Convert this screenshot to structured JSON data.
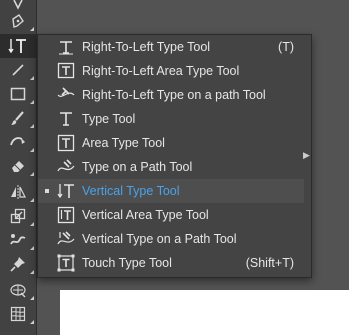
{
  "toolbar": {
    "tools": [
      {
        "name": "anchor-point-icon",
        "active": false
      },
      {
        "name": "pen-icon",
        "active": false
      },
      {
        "name": "vertical-type-icon",
        "active": true
      },
      {
        "name": "line-segment-icon",
        "active": false
      },
      {
        "name": "rectangle-icon",
        "active": false
      },
      {
        "name": "paintbrush-icon",
        "active": false
      },
      {
        "name": "shaper-icon",
        "active": false
      },
      {
        "name": "eraser-icon",
        "active": false
      },
      {
        "name": "reflect-icon",
        "active": false
      },
      {
        "name": "scale-icon",
        "active": false
      },
      {
        "name": "puppet-warp-icon",
        "active": false
      },
      {
        "name": "pin-icon",
        "active": false
      },
      {
        "name": "perspective-grid-icon",
        "active": false
      },
      {
        "name": "mesh-icon",
        "active": false
      }
    ]
  },
  "flyout": {
    "items": [
      {
        "label": "Right-To-Left Type Tool",
        "shortcut": "(T)",
        "icon": "rtl-type-icon",
        "selected": false
      },
      {
        "label": "Right-To-Left Area Type Tool",
        "shortcut": "",
        "icon": "rtl-area-type-icon",
        "selected": false
      },
      {
        "label": "Right-To-Left Type on a path Tool",
        "shortcut": "",
        "icon": "rtl-type-on-path-icon",
        "selected": false
      },
      {
        "label": "Type Tool",
        "shortcut": "",
        "icon": "type-icon",
        "selected": false
      },
      {
        "label": "Area Type Tool",
        "shortcut": "",
        "icon": "area-type-icon",
        "selected": false
      },
      {
        "label": "Type on a Path Tool",
        "shortcut": "",
        "icon": "type-on-path-icon",
        "selected": false
      },
      {
        "label": "Vertical Type Tool",
        "shortcut": "",
        "icon": "vertical-type-icon",
        "selected": true
      },
      {
        "label": "Vertical Area Type Tool",
        "shortcut": "",
        "icon": "vertical-area-type-icon",
        "selected": false
      },
      {
        "label": "Vertical Type on a Path Tool",
        "shortcut": "",
        "icon": "vertical-type-on-path-icon",
        "selected": false
      },
      {
        "label": "Touch Type Tool",
        "shortcut": "(Shift+T)",
        "icon": "touch-type-icon",
        "selected": false
      }
    ]
  },
  "colors": {
    "selected_label": "#4aa3e8",
    "menu_background": "#444444",
    "toolbar_background": "#424242",
    "canvas_background": "#535353",
    "artboard": "#ffffff"
  }
}
